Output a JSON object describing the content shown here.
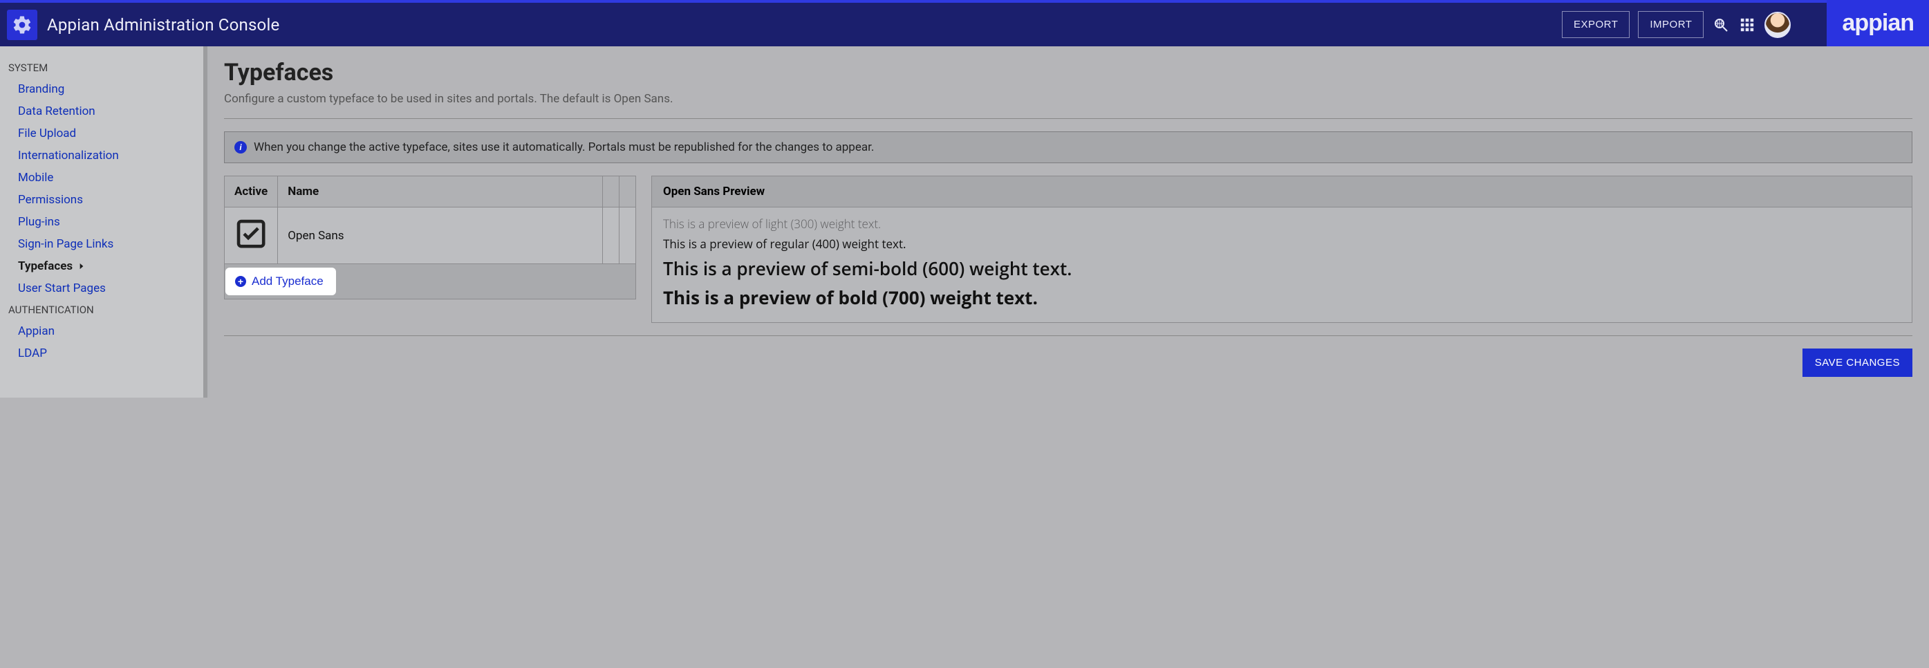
{
  "header": {
    "title": "Appian Administration Console",
    "export_label": "EXPORT",
    "import_label": "IMPORT",
    "logo_text": "appian"
  },
  "sidebar": {
    "section_system": "SYSTEM",
    "items_system": [
      "Branding",
      "Data Retention",
      "File Upload",
      "Internationalization",
      "Mobile",
      "Permissions",
      "Plug-ins",
      "Sign-in Page Links",
      "Typefaces",
      "User Start Pages"
    ],
    "active_item": "Typefaces",
    "section_auth": "AUTHENTICATION",
    "items_auth": [
      "Appian",
      "LDAP"
    ]
  },
  "page": {
    "title": "Typefaces",
    "subtitle": "Configure a custom typeface to be used in sites and portals. The default is Open Sans.",
    "info": "When you change the active typeface, sites use it automatically. Portals must be republished for the changes to appear."
  },
  "table": {
    "col_active": "Active",
    "col_name": "Name",
    "rows": [
      {
        "active": true,
        "name": "Open Sans"
      }
    ],
    "add_label": "Add Typeface"
  },
  "preview": {
    "title": "Open Sans Preview",
    "w300": "This is a preview of light (300) weight text.",
    "w400": "This is a preview of regular (400) weight text.",
    "w600": "This is a preview of semi-bold (600) weight text.",
    "w700": "This is a preview of bold (700) weight text."
  },
  "actions": {
    "save": "SAVE CHANGES"
  }
}
